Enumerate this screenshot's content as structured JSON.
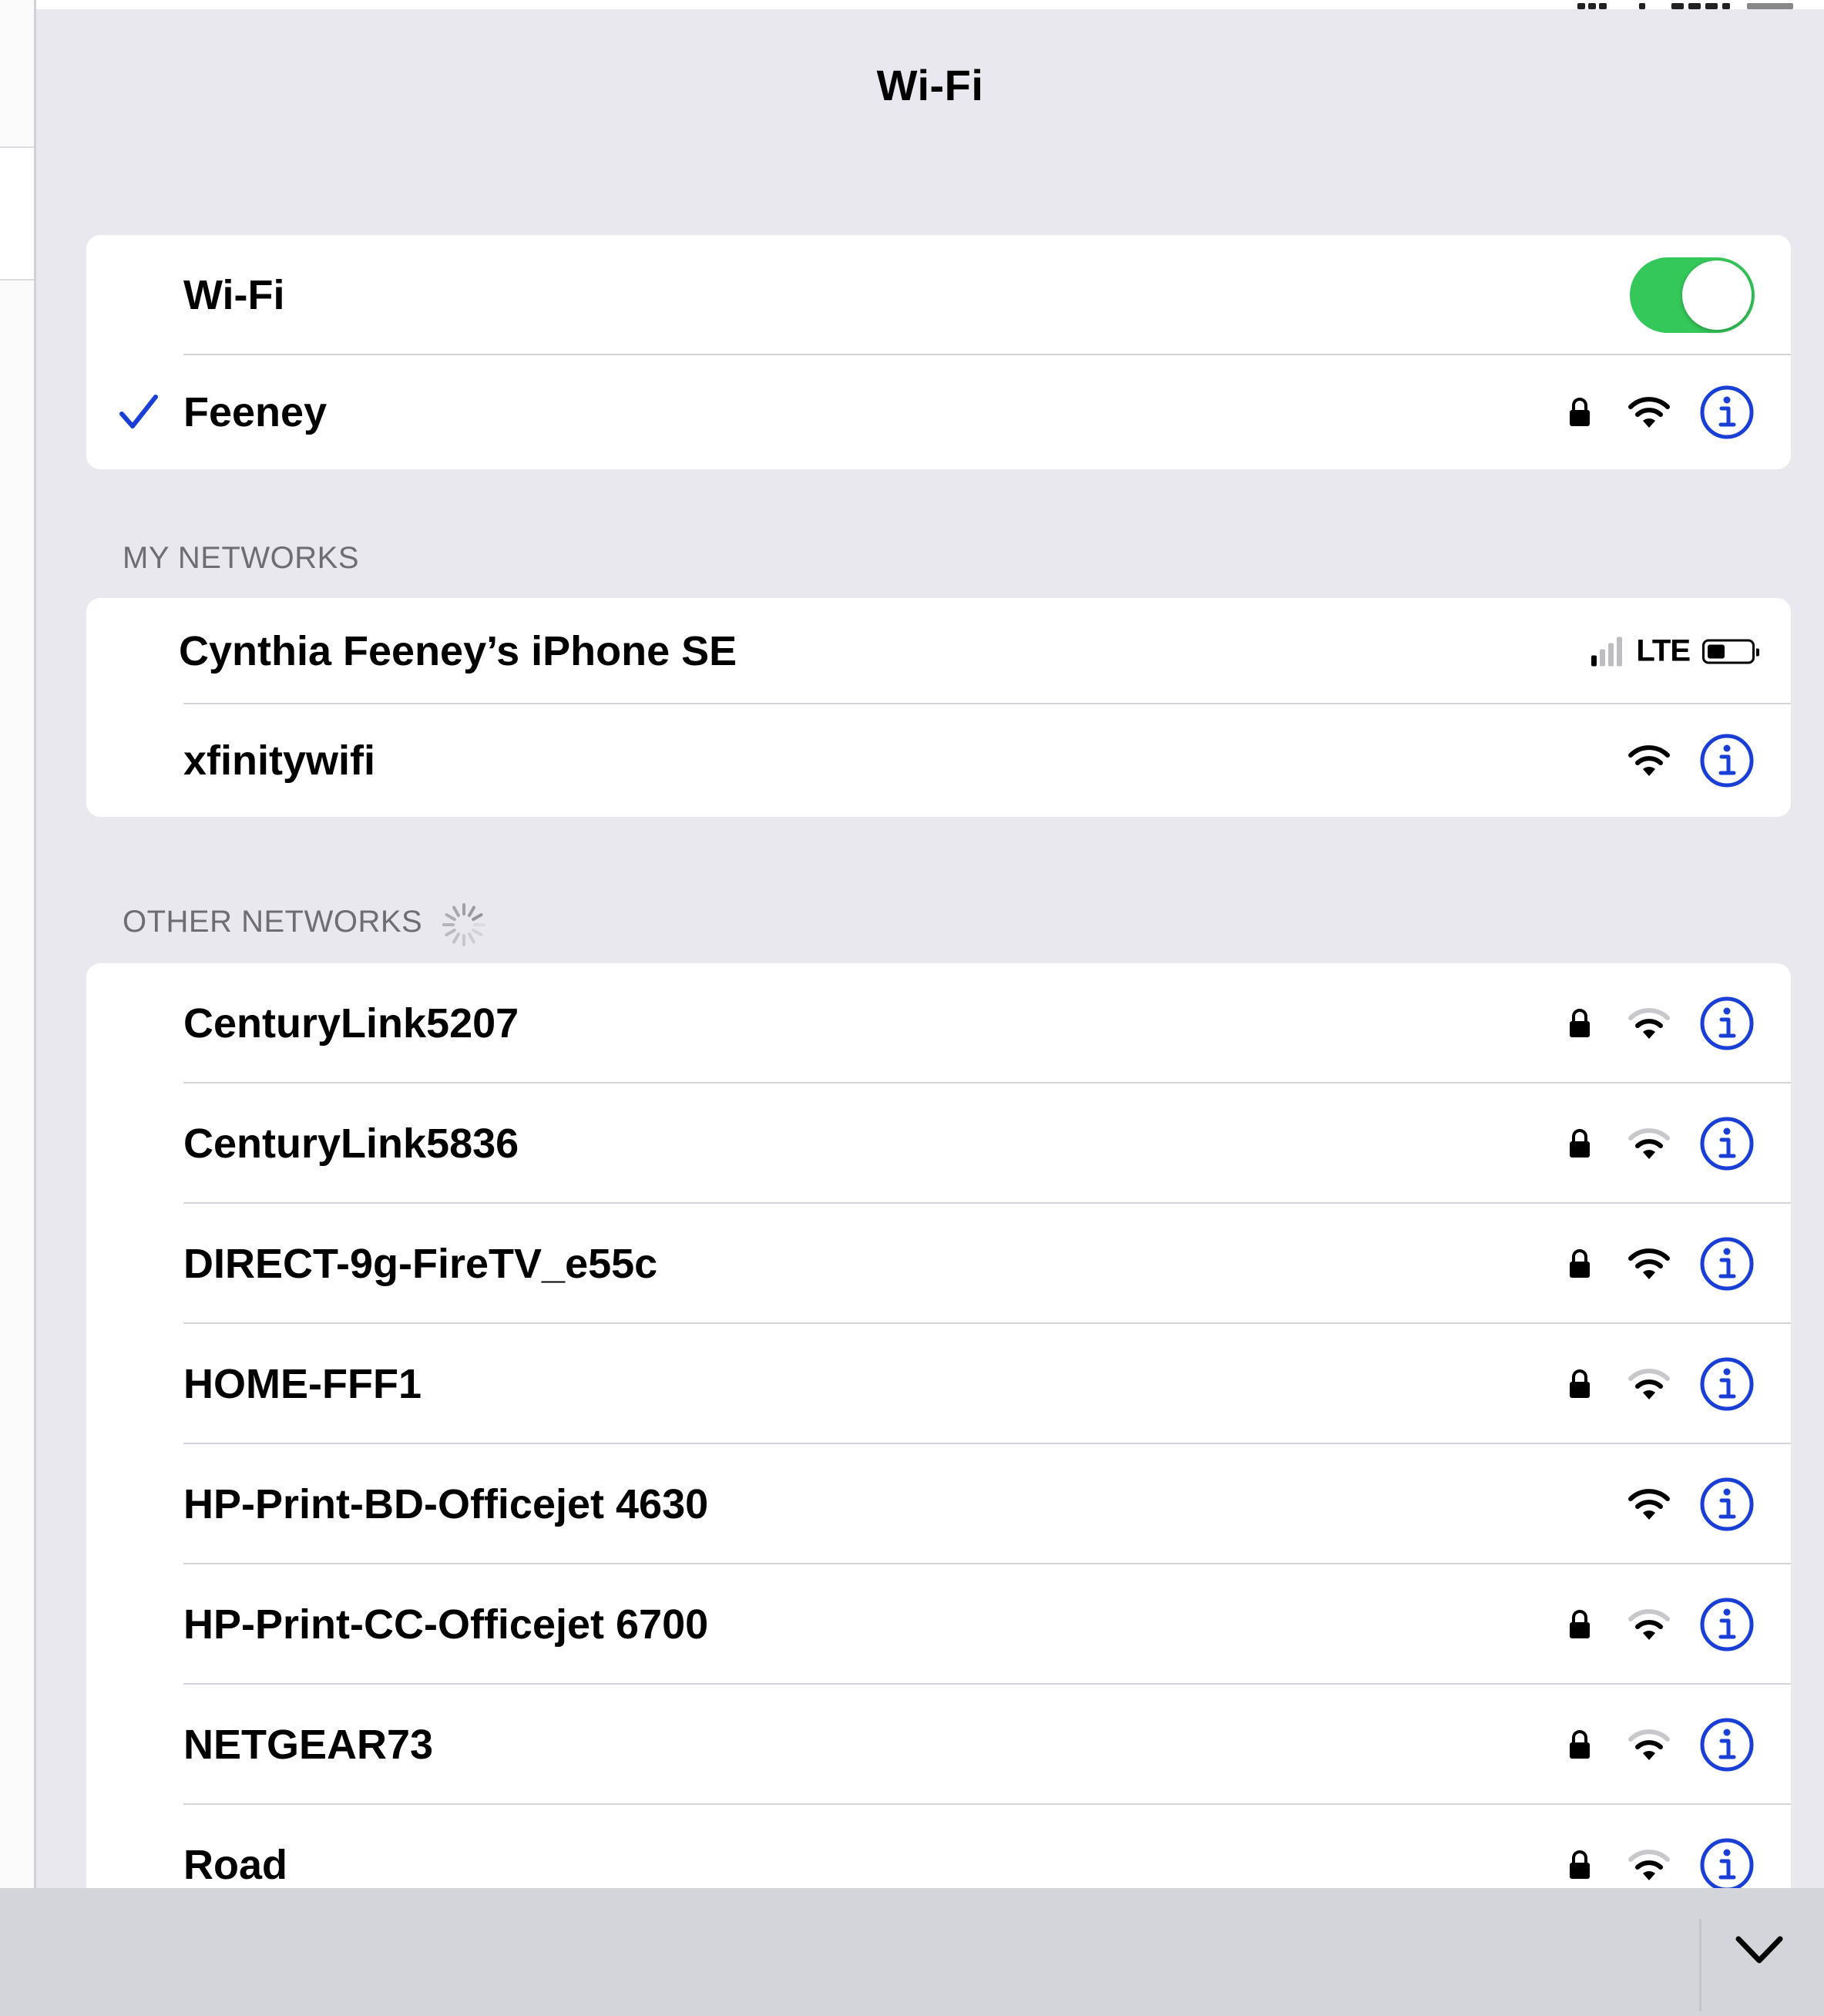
{
  "header": {
    "title": "Wi-Fi"
  },
  "wifi_group": {
    "toggle_label": "Wi-Fi",
    "toggle_on": true,
    "connected": {
      "name": "Feeney",
      "secured": true,
      "signal_bars": 3
    }
  },
  "my_networks": {
    "header": "MY NETWORKS",
    "hotspot": {
      "name": "Cynthia Feeney’s iPhone SE",
      "signal_bars": 1,
      "network_type": "LTE",
      "battery_level": 0.4
    },
    "items": [
      {
        "name": "xfinitywifi",
        "secured": false,
        "signal_bars": 3
      }
    ]
  },
  "other_networks": {
    "header": "OTHER NETWORKS",
    "items": [
      {
        "name": "CenturyLink5207",
        "secured": true,
        "signal_bars": 2
      },
      {
        "name": "CenturyLink5836",
        "secured": true,
        "signal_bars": 2
      },
      {
        "name": "DIRECT-9g-FireTV_e55c",
        "secured": true,
        "signal_bars": 3
      },
      {
        "name": "HOME-FFF1",
        "secured": true,
        "signal_bars": 2
      },
      {
        "name": "HP-Print-BD-Officejet 4630",
        "secured": false,
        "signal_bars": 3
      },
      {
        "name": "HP-Print-CC-Officejet 6700",
        "secured": true,
        "signal_bars": 2
      },
      {
        "name": "NETGEAR73",
        "secured": true,
        "signal_bars": 2
      },
      {
        "name": "Road",
        "secured": true,
        "signal_bars": 2
      }
    ]
  },
  "colors": {
    "accent": "#1a3fd6",
    "toggle_on": "#34c759",
    "background": "#e9e8ee",
    "row": "#ffffff",
    "section_text": "#6d6d72"
  },
  "icons": {
    "checkmark": "checkmark-icon",
    "lock": "lock-icon",
    "wifi": "wifi-icon",
    "info": "info-icon",
    "spinner": "spinner-icon",
    "chevron": "chevron-down-icon"
  }
}
